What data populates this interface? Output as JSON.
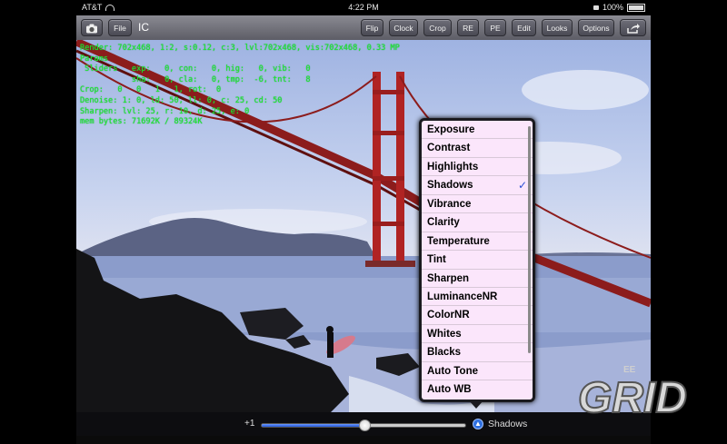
{
  "status_bar": {
    "carrier": "AT&T",
    "time": "4:22 PM",
    "battery": "100%"
  },
  "toolbar": {
    "title": "IC",
    "file_label": "File",
    "buttons": [
      "Flip",
      "Clock",
      "Crop",
      "RE",
      "PE",
      "Edit",
      "Looks",
      "Options"
    ]
  },
  "info_overlay": [
    "Render: 702x468, 1:2, s:0.12, c:3, lvl:702x468, vis:702x468, 0.33 MP",
    "Params",
    " Sliders   exp:   0, con:   0, hig:   0, vib:   0",
    "           sha:   0, cla:   0, tmp:  -6, tnt:   8",
    "Crop:   0   0   1   1, rot:  0",
    "Denoise: 1: 0, ld: 50, ll: 0, c: 25, cd: 50",
    "Sharpen: lvl: 25, r: 10, d: 25, e: 0",
    "mem bytes: 71692K / 89324K"
  ],
  "menu": {
    "items": [
      "Exposure",
      "Contrast",
      "Highlights",
      "Shadows",
      "Vibrance",
      "Clarity",
      "Temperature",
      "Tint",
      "Sharpen",
      "LuminanceNR",
      "ColorNR",
      "Whites",
      "Blacks",
      "Auto Tone",
      "Auto WB"
    ],
    "checked": "Shadows",
    "check_glyph": "✓"
  },
  "slider": {
    "value_label": "+1",
    "level": 0.5,
    "selected_label": "Shadows"
  },
  "watermark": {
    "text": "GRID",
    "prefix": "EE"
  },
  "colors": {
    "toolbar": "#6a6a74",
    "menu_bg": "#fbe6fb",
    "overlay_text": "#22e82a",
    "slider_fill": "#2054d8"
  }
}
